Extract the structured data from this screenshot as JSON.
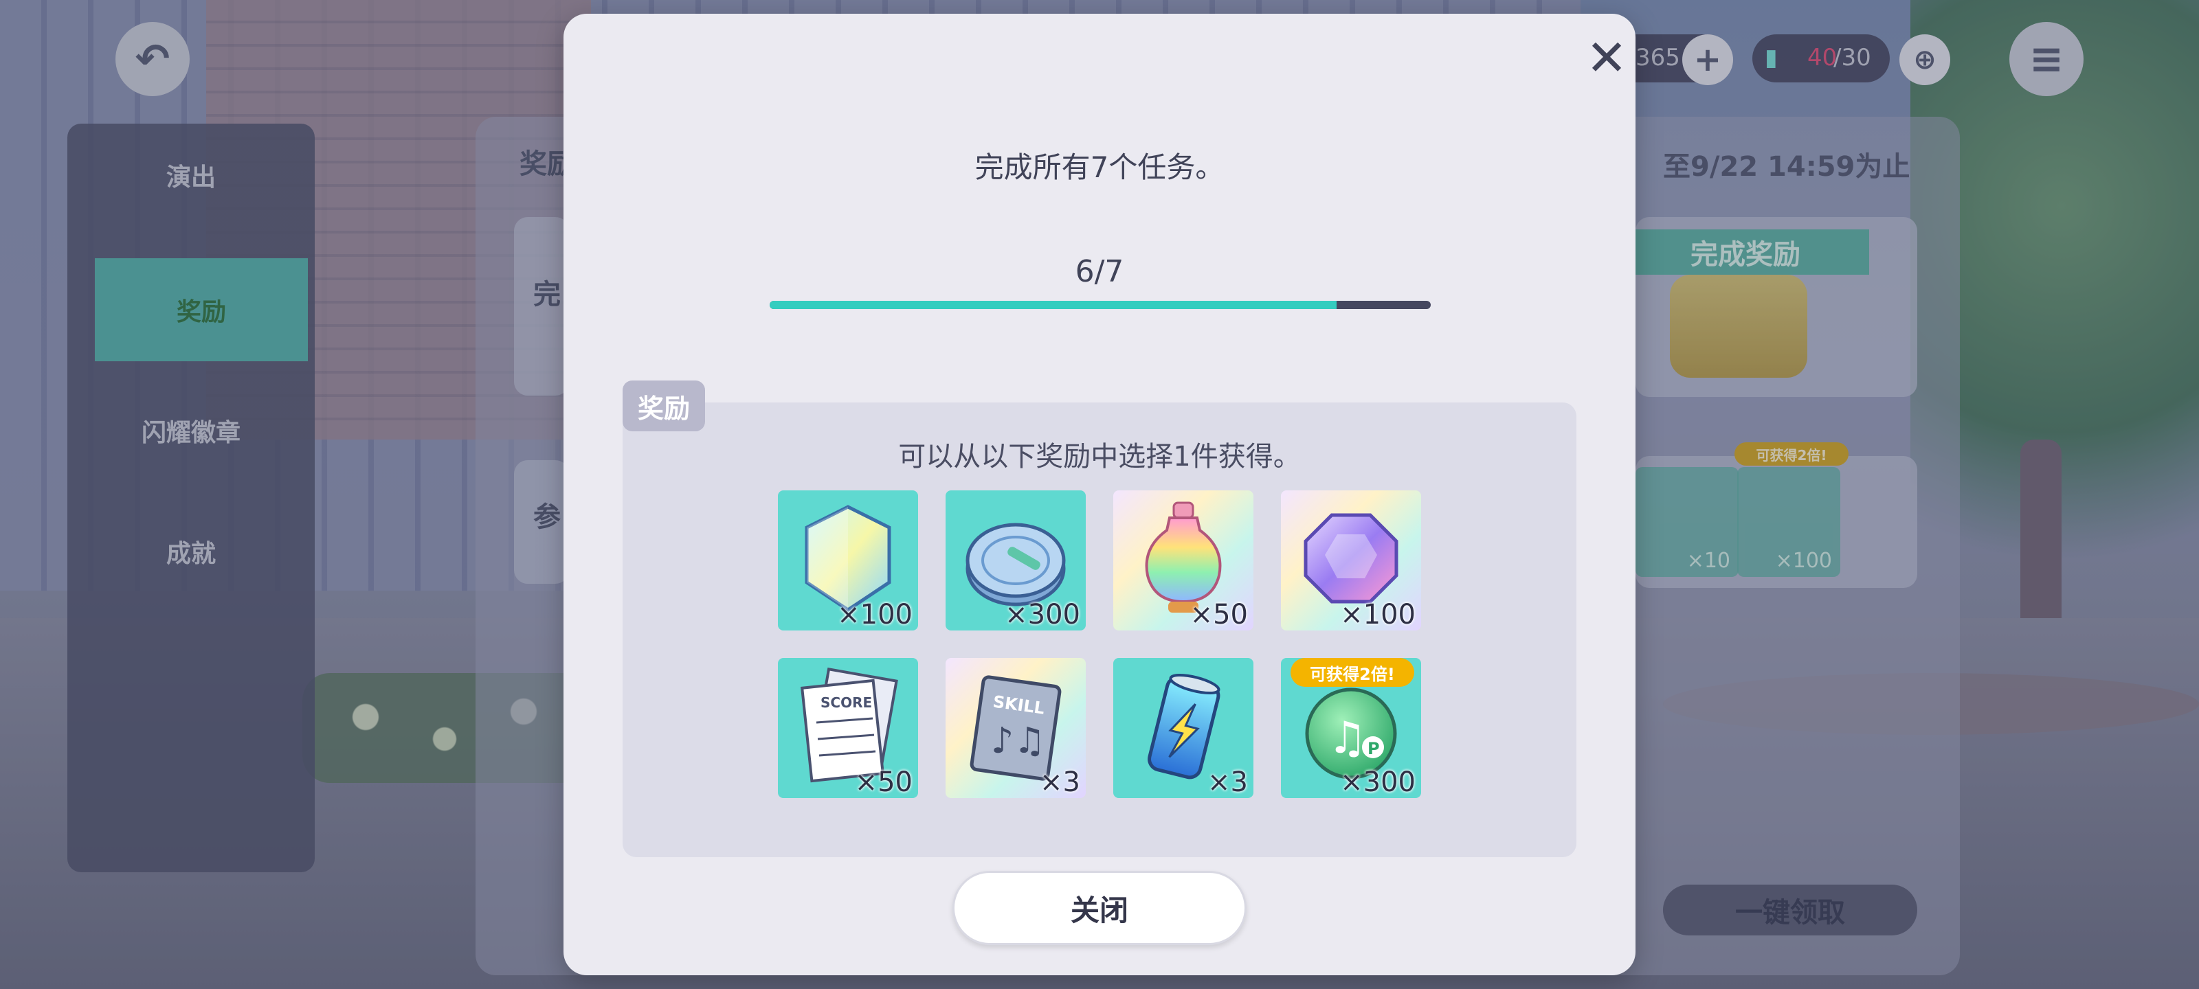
{
  "background": {
    "menu_items": [
      "演出",
      "奖励",
      "闪耀徽章",
      "成就"
    ],
    "active_menu_index": 1,
    "hud": {
      "currency_fragment": "365",
      "stamina_current": "40",
      "stamina_max": "/30"
    },
    "panel": {
      "tab_fragment": "奖励",
      "deadline": "至9/22 14:59为止",
      "card1_fragment": "完",
      "card2_fragment": "参",
      "ribbon": "完成奖励",
      "mini_badge": "可获得2倍!",
      "mini_qty_1": "×10",
      "mini_qty_2": "×100",
      "claim_all": "一键领取"
    }
  },
  "modal": {
    "mission_text": "完成所有7个任务。",
    "progress": {
      "label": "6/7",
      "current": 6,
      "total": 7
    },
    "reward_tag": "奖励",
    "choose_text": "可以从以下奖励中选择1件获得。",
    "rewards": [
      {
        "icon": "crystal-icon",
        "qty": "×100",
        "bg": "teal"
      },
      {
        "icon": "coin-icon",
        "qty": "×300",
        "bg": "teal"
      },
      {
        "icon": "rainbow-bottle-icon",
        "qty": "×50",
        "bg": "rainbow"
      },
      {
        "icon": "jewel-icon",
        "qty": "×100",
        "bg": "rainbow"
      },
      {
        "icon": "score-sheet-icon",
        "qty": "×50",
        "bg": "teal"
      },
      {
        "icon": "skill-book-icon",
        "qty": "×3",
        "bg": "rainbow"
      },
      {
        "icon": "energy-drink-icon",
        "qty": "×3",
        "bg": "teal"
      },
      {
        "icon": "music-point-icon",
        "qty": "×300",
        "bg": "teal"
      }
    ],
    "bonus_badge": "可获得2倍!",
    "close_label": "关闭"
  },
  "colors": {
    "accent": "#34cdbf",
    "tile_teal": "#5fd9d0",
    "badge": "#f4b400",
    "text": "#404358"
  }
}
